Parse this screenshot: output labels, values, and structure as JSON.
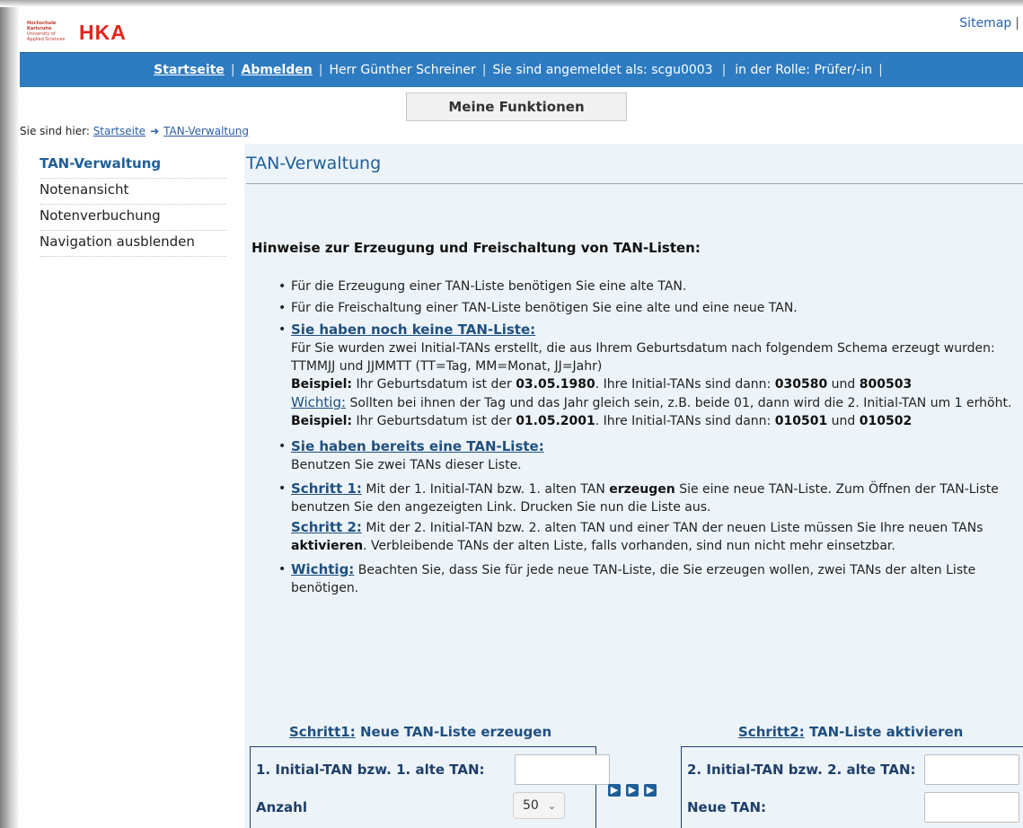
{
  "header": {
    "logo_small_line1": "Hochschule Karlsruhe",
    "logo_small_line2": "University of",
    "logo_small_line3": "Applied Sciences",
    "logo_text": "HKA",
    "sitemap": "Sitemap",
    "sitemap_sep": "|"
  },
  "topbar": {
    "home": "Startseite",
    "logout_first": "A",
    "logout_rest": "bmelden",
    "user": "Herr Günther Schreiner",
    "logged_in_as": "Sie sind angemeldet als: scgu0003",
    "role": "in der Rolle: Prüfer/-in",
    "sep": "|"
  },
  "functions_button": "Meine Funktionen",
  "breadcrumb": {
    "prefix": "Sie sind hier:",
    "home": "Startseite",
    "current": "TAN-Verwaltung"
  },
  "sidebar": {
    "items": [
      {
        "label": "TAN-Verwaltung"
      },
      {
        "label": "Notenansicht"
      },
      {
        "label": "Notenverbuchung"
      },
      {
        "label": "Navigation ausblenden"
      }
    ]
  },
  "main": {
    "title": "TAN-Verwaltung",
    "hint_title": "Hinweise zur Erzeugung und Freischaltung von TAN-Listen:",
    "b1": "Für die Erzeugung einer TAN-Liste benötigen Sie eine alte TAN.",
    "b2": "Für die Freischaltung einer TAN-Liste benötigen Sie eine alte und eine neue TAN.",
    "b3_head": "Sie haben noch keine TAN-Liste:",
    "b3_p1": "Für Sie wurden zwei Initial-TANs erstellt, die aus Ihrem Geburtsdatum nach folgendem Schema erzeugt wurden:",
    "b3_p2": "TTMMJJ und JJMMTT (TT=Tag, MM=Monat, JJ=Jahr)",
    "ex_label": "Beispiel:",
    "ex1_a": "Ihr Geburtsdatum ist der",
    "ex1_date": "03.05.1980",
    "ex1_b": ". Ihre Initial-TANs sind dann:",
    "ex1_t1": "030580",
    "und": "und",
    "ex1_t2": "800503",
    "wichtig": "Wichtig:",
    "w1_text": "Sollten bei ihnen der Tag und das Jahr gleich sein, z.B. beide 01, dann wird die 2. Initial-TAN um 1 erhöht.",
    "ex2_a": "Ihr Geburtsdatum ist der",
    "ex2_date": "01.05.2001",
    "ex2_b": ". Ihre Initial-TANs sind dann:",
    "ex2_t1": "010501",
    "ex2_t2": "010502",
    "b4_head": "Sie haben bereits eine TAN-Liste:",
    "b4_text": "Benutzen Sie zwei TANs dieser Liste.",
    "s1_label": "Schritt 1:",
    "s1_a": "Mit der 1. Initial-TAN bzw. 1. alten TAN",
    "s1_bold": "erzeugen",
    "s1_b": "Sie eine neue TAN-Liste. Zum Öffnen der TAN-Liste benutzen Sie den angezeigten Link. Drucken Sie nun die Liste aus.",
    "s2_label": "Schritt 2:",
    "s2_a": "Mit der 2. Initial-TAN bzw. 2. alten TAN und einer TAN der neuen Liste müssen Sie Ihre neuen TANs",
    "s2_bold": "aktivieren",
    "s2_b": ". Verbleibende TANs der alten Liste, falls vorhanden, sind nun nicht mehr einsetzbar.",
    "w2_text": "Beachten Sie, dass Sie für jede neue TAN-Liste, die Sie erzeugen wollen, zwei TANs der alten Liste benötigen."
  },
  "form1": {
    "title_u": "Schritt1:",
    "title_rest": "Neue TAN-Liste erzeugen",
    "tan_label": "1. Initial-TAN bzw. 1. alte TAN:",
    "tan_value": "",
    "count_label": "Anzahl",
    "count_value": "50"
  },
  "form2": {
    "title_u": "Schritt2:",
    "title_rest": "TAN-Liste aktivieren",
    "tan_label": "2. Initial-TAN bzw. 2. alte TAN:",
    "tan_value": "",
    "new_label": "Neue TAN:",
    "new_value": ""
  },
  "icons": {
    "arrow": "▶"
  },
  "colors": {
    "topbar": "#2d7bc1",
    "link": "#2a5fa8",
    "heading": "#1f5f99",
    "content_bg": "#edf4f9",
    "logo": "#e3241b"
  }
}
